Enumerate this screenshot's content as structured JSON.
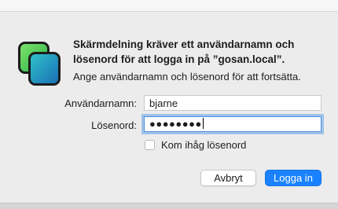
{
  "dialog": {
    "title": "Skärmdelning kräver ett användarnamn och lösenord för att logga in på ”gosan.local”.",
    "subtitle": "Ange användarnamn och lösenord för att fortsätta.",
    "icon": "screen-sharing-app-icon"
  },
  "form": {
    "username_label": "Användarnamn:",
    "username_value": "bjarne",
    "password_label": "Lösenord:",
    "password_masked": "●●●●●●●●",
    "remember_label": "Kom ihåg lösenord",
    "remember_checked": false
  },
  "buttons": {
    "cancel_label": "Avbryt",
    "login_label": "Logga in"
  },
  "colors": {
    "accent": "#1a82ff",
    "focus_ring": "#4a90e2",
    "icon_green": "#34c759",
    "icon_teal": "#1fb3c8"
  }
}
